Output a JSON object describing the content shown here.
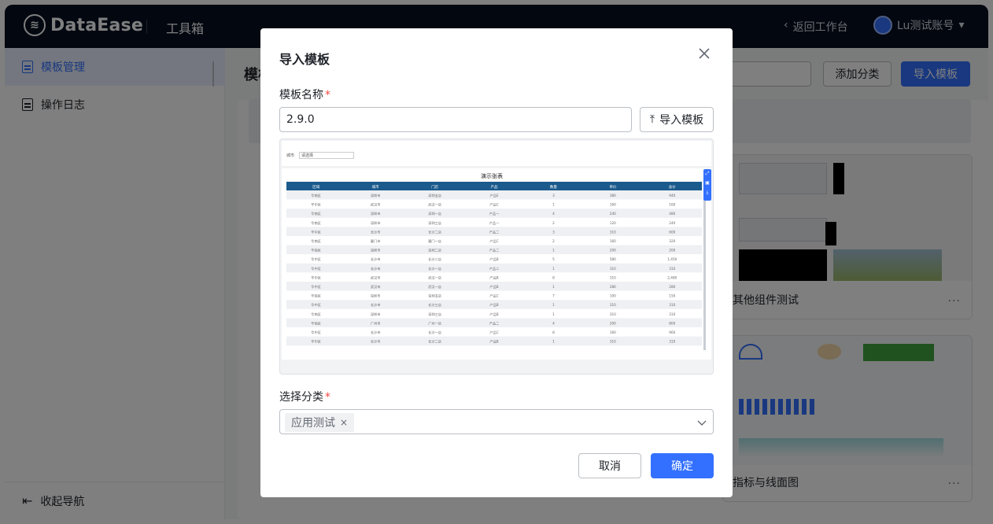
{
  "topbar": {
    "logo_text": "DataEase",
    "title": "工具箱",
    "back_label": "返回工作台",
    "user_name": "Lu测试账号"
  },
  "sidebar": {
    "items": [
      {
        "label": "模板管理",
        "active": true
      },
      {
        "label": "操作日志",
        "active": false
      }
    ],
    "collapse_label": "收起导航"
  },
  "main": {
    "title": "模板管理",
    "add_category_label": "添加分类",
    "import_template_label": "导入模板",
    "cards": [
      {
        "name": "其他组件测试"
      },
      {
        "name": "指标与线面图"
      }
    ]
  },
  "modal": {
    "title": "导入模板",
    "name_label": "模板名称",
    "required_mark": "*",
    "name_value": "2.9.0",
    "import_button_label": "导入模板",
    "category_label": "选择分类",
    "selected_category": "应用测试",
    "cancel_label": "取消",
    "confirm_label": "确定",
    "preview": {
      "filter_label": "城市",
      "filter_placeholder": "请选择",
      "table_title": "演示张表",
      "columns": [
        "区域",
        "城市",
        "门店",
        "产品",
        "数量",
        "单价",
        "总价"
      ],
      "rows": [
        [
          "华南区",
          "深圳市",
          "深圳五店",
          "产品E",
          "3",
          "380",
          "940"
        ],
        [
          "华中区",
          "武汉市",
          "武汉一店",
          "产品C",
          "1",
          "160",
          "160"
        ],
        [
          "华南区",
          "深圳市",
          "深圳一店",
          "产品一",
          "4",
          "240",
          "480"
        ],
        [
          "华南区",
          "深圳市",
          "深圳三店",
          "产品一",
          "2",
          "120",
          "240"
        ],
        [
          "华中区",
          "长沙市",
          "长沙二店",
          "产品二",
          "3",
          "310",
          "600"
        ],
        [
          "华南区",
          "厦门市",
          "厦门一店",
          "产品C",
          "2",
          "160",
          "320"
        ],
        [
          "华南区",
          "深圳市",
          "深圳二店",
          "产品二",
          "1",
          "200",
          "200"
        ],
        [
          "华中区",
          "长沙市",
          "长沙二店",
          "产品B",
          "5",
          "580",
          "1,450"
        ],
        [
          "华中区",
          "长沙市",
          "长沙一店",
          "产品二",
          "1",
          "310",
          "310"
        ],
        [
          "华中区",
          "武汉市",
          "武汉一店",
          "产品B",
          "8",
          "310",
          "2,480"
        ],
        [
          "华中区",
          "武汉市",
          "武汉一店",
          "产品B",
          "1",
          "280",
          "280"
        ],
        [
          "华南区",
          "深圳市",
          "深圳五店",
          "产品C",
          "7",
          "100",
          "150"
        ],
        [
          "华中区",
          "长沙市",
          "长沙三店",
          "产品B",
          "1",
          "310",
          "310"
        ],
        [
          "华南区",
          "深圳市",
          "深圳三店",
          "产品B",
          "1",
          "310",
          "310"
        ],
        [
          "华南区",
          "广州市",
          "广州一店",
          "产品二",
          "4",
          "200",
          "800"
        ],
        [
          "华中区",
          "长沙市",
          "长沙一店",
          "产品C",
          "8",
          "160",
          "960"
        ],
        [
          "华中区",
          "长沙市",
          "长沙二店",
          "产品B",
          "1",
          "310",
          "310"
        ]
      ]
    }
  },
  "colors": {
    "primary": "#3370ff",
    "topbar": "#050e21",
    "table_header": "#1b5a8c",
    "required": "#f54a45"
  }
}
